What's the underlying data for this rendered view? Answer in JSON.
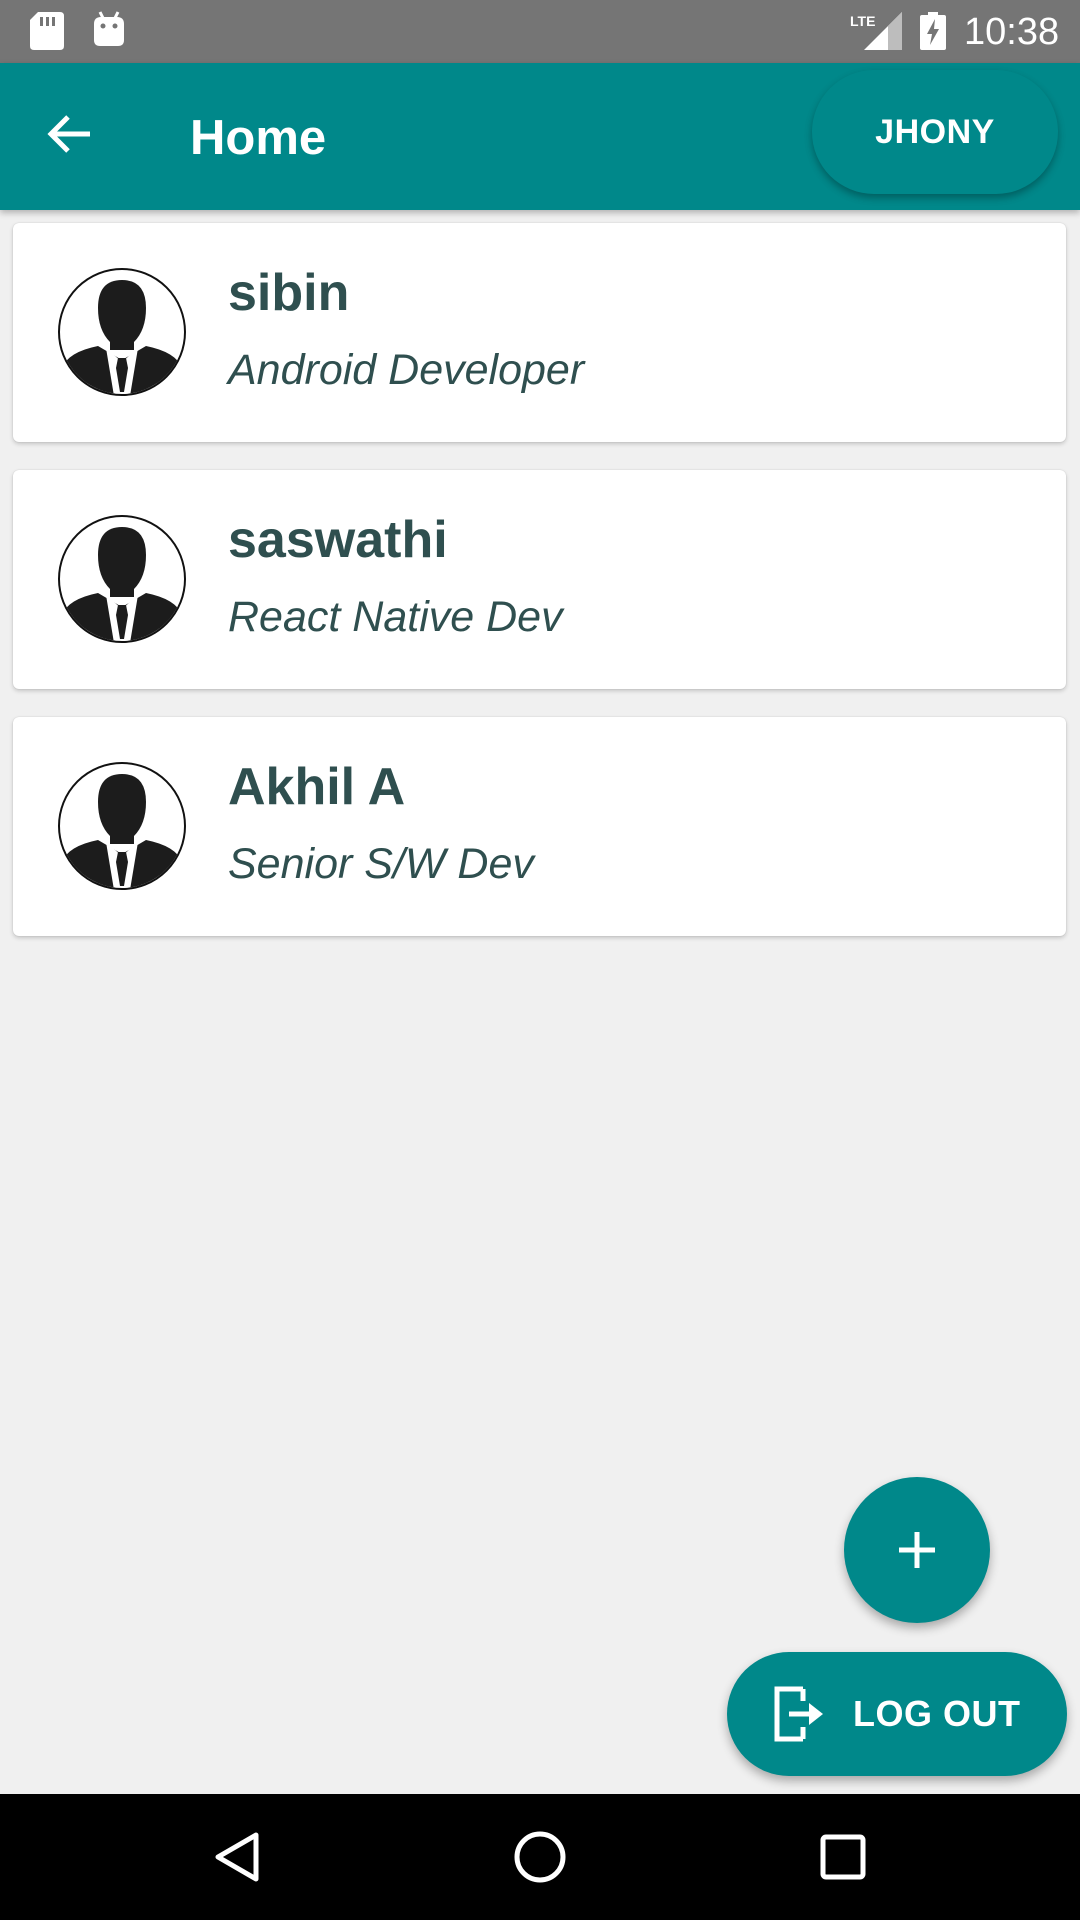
{
  "status_bar": {
    "time": "10:38",
    "network": "LTE",
    "icons": [
      "sd-card-icon",
      "android-icon",
      "lte-signal-icon",
      "battery-charging-icon"
    ]
  },
  "app_bar": {
    "title": "Home",
    "user_button": "JHONY",
    "back_icon": "arrow-back-icon"
  },
  "cards": [
    {
      "name": "sibin",
      "role": "Android Developer"
    },
    {
      "name": "saswathi",
      "role": "React Native Dev"
    },
    {
      "name": "Akhil A",
      "role": "Senior S/W Dev"
    }
  ],
  "fab": {
    "icon": "plus-icon"
  },
  "logout": {
    "label": "LOG OUT",
    "icon": "exit-icon"
  },
  "nav_bar": {
    "icons": [
      "back-triangle-icon",
      "home-circle-icon",
      "recents-square-icon"
    ]
  },
  "colors": {
    "primary": "#00888a",
    "text": "#2f4f4f",
    "background": "#f0f0f0"
  }
}
